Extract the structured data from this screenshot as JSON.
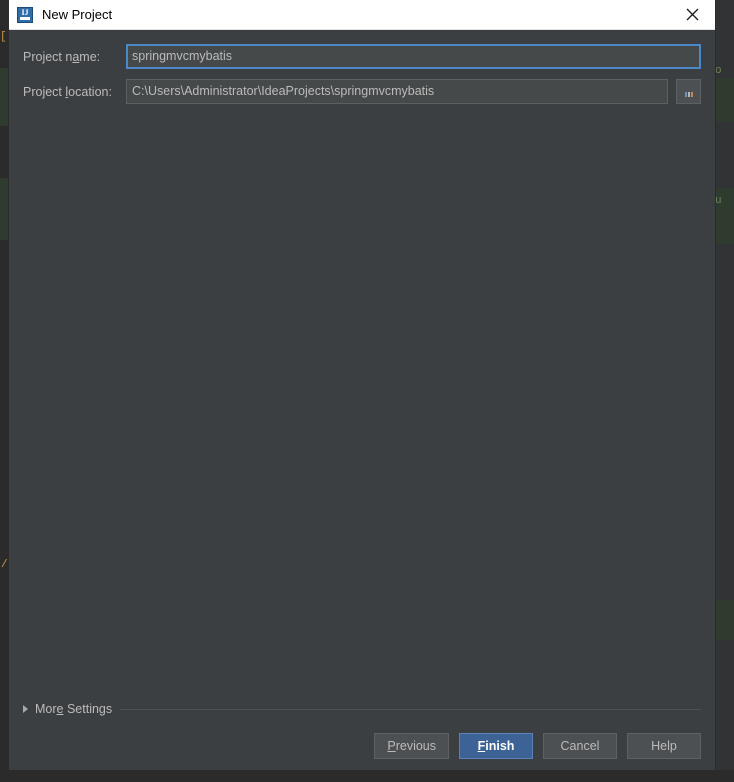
{
  "window": {
    "title": "New Project",
    "app_icon": "intellij-idea-icon",
    "icon_letters": "IJ",
    "close_icon": "close-icon",
    "title_bar_bg": "#ffffff",
    "body_bg": "#3c3f41"
  },
  "form": {
    "project_name": {
      "label_before": "Project n",
      "label_mnemonic": "a",
      "label_after": "me:",
      "value": "springmvcmybatis",
      "placeholder": "",
      "focused": true
    },
    "project_location": {
      "label_before": "Project ",
      "label_mnemonic": "l",
      "label_after": "ocation:",
      "value": "C:\\Users\\Administrator\\IdeaProjects\\springmvcmybatis",
      "placeholder": "",
      "browse_label": "...",
      "browse_icon": "ellipsis-browse-icon"
    }
  },
  "more_settings": {
    "label_before": "Mor",
    "label_mnemonic": "e",
    "label_after": " Settings",
    "expanded": false,
    "disclosure_icon": "chevron-right-icon"
  },
  "buttons": [
    {
      "name": "previous",
      "before": "",
      "mnemonic": "P",
      "after": "revious",
      "default": false
    },
    {
      "name": "finish",
      "before": "",
      "mnemonic": "F",
      "after": "inish",
      "default": true
    },
    {
      "name": "cancel",
      "before": "Cancel",
      "mnemonic": "",
      "after": "",
      "default": false
    },
    {
      "name": "help",
      "before": "Help",
      "mnemonic": "",
      "after": "",
      "default": false
    }
  ],
  "colors": {
    "accent": "#3c6296",
    "focus_border": "#4a88c7",
    "field_bg": "#45494a",
    "button_bg": "#4c5052",
    "text": "#bbbbbb"
  },
  "backdrop": {
    "editor_bg": "#2b2b2b",
    "highlight_band": "#2f3b2f",
    "left_glyphs": [
      "[",
      "/"
    ],
    "right_glyphs": [
      "o",
      "u"
    ]
  }
}
